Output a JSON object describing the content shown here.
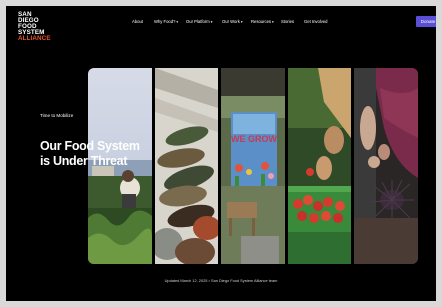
{
  "logo": {
    "lines": [
      "SAN",
      "DIEGO",
      "FOOD",
      "SYSTEM",
      "ALLIANCE"
    ]
  },
  "nav": {
    "items": [
      {
        "label": "About"
      },
      {
        "label": "Why Food?",
        "has_dropdown": true
      },
      {
        "label": "Our Platform",
        "has_dropdown": true
      },
      {
        "label": "Our Work",
        "has_dropdown": true
      },
      {
        "label": "Resources",
        "has_dropdown": true
      },
      {
        "label": "Stories"
      },
      {
        "label": "Get Involved"
      }
    ],
    "cta_label": "Donate"
  },
  "hero": {
    "eyebrow": "Time to Mobilize",
    "headline_line1": "Our Food System",
    "headline_line2": "is Under Threat",
    "sign_text": "WE GROW"
  },
  "footer": {
    "updated_text": "Updated March 12, 2025 • San Diego Food System Alliance team"
  },
  "colors": {
    "background": "#000000",
    "accent": "#5a4fd6",
    "logo_accent": "#e8542f"
  }
}
